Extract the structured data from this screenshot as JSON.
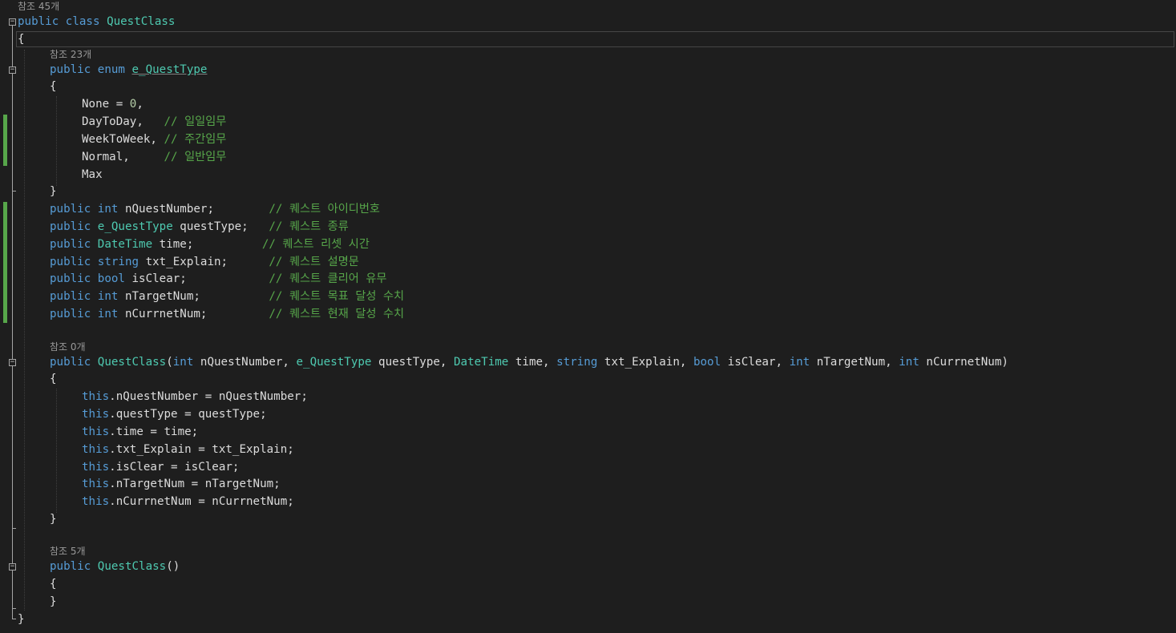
{
  "editor": {
    "language": "C#",
    "theme_colors": {
      "background": "#1e1e1e",
      "keyword": "#569cd6",
      "type": "#4ec9b0",
      "number": "#b5cea8",
      "comment": "#57a64a",
      "text": "#dcdcdc",
      "codelens": "#999999",
      "change_marker": "#57a64a"
    },
    "codelens": {
      "class_refs": "참조 45개",
      "enum_refs": "참조 23개",
      "ctor_refs": "참조 0개",
      "default_ctor_refs": "참조 5개"
    },
    "lines": {
      "class_decl": {
        "kw1": "public",
        "kw2": "class",
        "name": "QuestClass"
      },
      "open1": "{",
      "enum_decl": {
        "kw1": "public",
        "kw2": "enum",
        "name": "e_QuestType"
      },
      "open2": "{",
      "enum_none": {
        "text": "None = ",
        "value": "0",
        "tail": ","
      },
      "enum_day": {
        "text": "DayToDay,   ",
        "comment": "// 일일임무"
      },
      "enum_week": {
        "text": "WeekToWeek, ",
        "comment": "// 주간임무"
      },
      "enum_normal": {
        "text": "Normal,     ",
        "comment": "// 일반임무"
      },
      "enum_max": {
        "text": "Max"
      },
      "close2": "}",
      "field1": {
        "kw": "public",
        "type": "int",
        "rest": " nQuestNumber;        ",
        "comment": "// 퀘스트 아이디번호"
      },
      "field2": {
        "kw": "public",
        "type": "e_QuestType",
        "rest": " questType;   ",
        "comment": "// 퀘스트 종류"
      },
      "field3": {
        "kw": "public",
        "type": "DateTime",
        "rest": " time;          ",
        "comment": "// 퀘스트 리셋 시간"
      },
      "field4": {
        "kw": "public",
        "type": "string",
        "rest": " txt_Explain;      ",
        "comment": "// 퀘스트 설명문"
      },
      "field5": {
        "kw": "public",
        "type": "bool",
        "rest": " isClear;            ",
        "comment": "// 퀘스트 클리어 유무"
      },
      "field6": {
        "kw": "public",
        "type": "int",
        "rest": " nTargetNum;          ",
        "comment": "// 퀘스트 목표 달성 수치"
      },
      "field7": {
        "kw": "public",
        "type": "int",
        "rest": " nCurrnetNum;         ",
        "comment": "// 퀘스트 현재 달성 수치"
      },
      "ctor_decl": {
        "kw": "public",
        "name": "QuestClass",
        "p1t": "int",
        "p1n": " nQuestNumber, ",
        "p2t": "e_QuestType",
        "p2n": " questType, ",
        "p3t": "DateTime",
        "p3n": " time, ",
        "p4t": "string",
        "p4n": " txt_Explain, ",
        "p5t": "bool",
        "p5n": " isClear, ",
        "p6t": "int",
        "p6n": " nTargetNum, ",
        "p7t": "int",
        "p7n": " nCurrnetNum)"
      },
      "open3": "{",
      "assign1": {
        "this": "this",
        "rest": ".nQuestNumber = nQuestNumber;"
      },
      "assign2": {
        "this": "this",
        "rest": ".questType = questType;"
      },
      "assign3": {
        "this": "this",
        "rest": ".time = time;"
      },
      "assign4": {
        "this": "this",
        "rest": ".txt_Explain = txt_Explain;"
      },
      "assign5": {
        "this": "this",
        "rest": ".isClear = isClear;"
      },
      "assign6": {
        "this": "this",
        "rest": ".nTargetNum = nTargetNum;"
      },
      "assign7": {
        "this": "this",
        "rest": ".nCurrnetNum = nCurrnetNum;"
      },
      "close3": "}",
      "default_ctor": {
        "kw": "public",
        "name": "QuestClass",
        "parens": "()"
      },
      "open4": "{",
      "close4": "}",
      "close1": "}"
    }
  }
}
